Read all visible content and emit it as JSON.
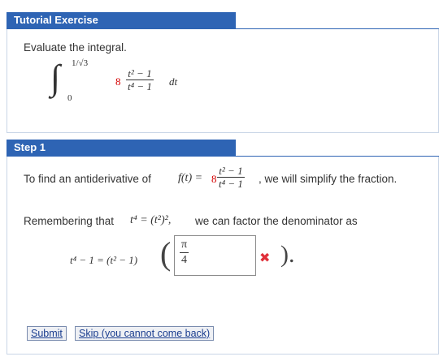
{
  "tutorial": {
    "header": "Tutorial Exercise",
    "prompt": "Evaluate the integral.",
    "integral": {
      "upper_limit": "1/√3",
      "lower_limit": "0",
      "coefficient": "8",
      "numerator": "t² − 1",
      "denominator": "t⁴ − 1",
      "differential": "dt"
    }
  },
  "step1": {
    "header": "Step 1",
    "intro_prefix": "To find an antiderivative of",
    "function_label": "f(t) =",
    "function_coefficient": "8",
    "function_numerator": "t² − 1",
    "function_denominator": "t⁴ − 1",
    "intro_suffix": ", we will simplify the fraction.",
    "remember_prefix": "Remembering that",
    "remember_identity": "t⁴ = (t²)²,",
    "remember_suffix": "we can factor the denominator as",
    "factor_lhs": "t⁴ − 1 = (t² − 1)",
    "answer_numerator": "π",
    "answer_denominator": "4",
    "answer_status": "incorrect",
    "close_paren": ")."
  },
  "buttons": {
    "submit": "Submit",
    "skip": "Skip (you cannot come back)"
  },
  "colors": {
    "header_bg": "#2e64b4",
    "accent_red": "#d40000",
    "incorrect_mark": "#e0303a"
  }
}
